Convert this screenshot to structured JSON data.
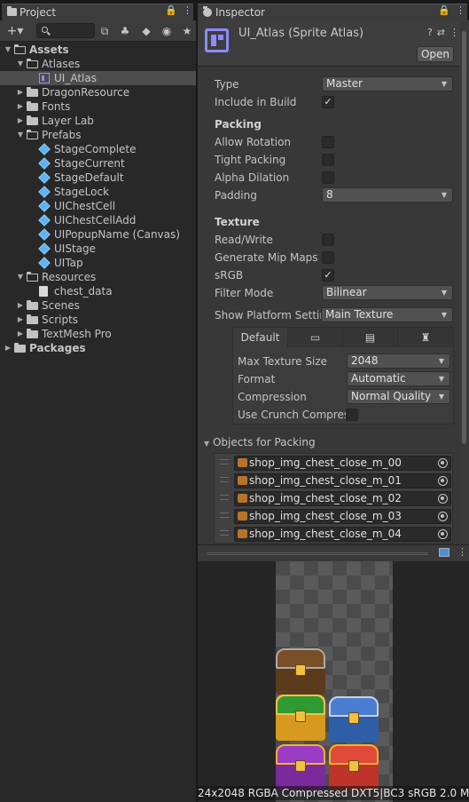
{
  "project": {
    "tab_label": "Project",
    "tab_controls": "🔒 ⋮",
    "toolbar": {
      "add": "+▾",
      "search_placeholder": ""
    },
    "tree": [
      {
        "label": "Assets",
        "indent": 0,
        "icon": "folder-open",
        "arrow": "▼",
        "bold": true
      },
      {
        "label": "Atlases",
        "indent": 1,
        "icon": "folder-open",
        "arrow": "▼"
      },
      {
        "label": "UI_Atlas",
        "indent": 2,
        "icon": "sprite-atlas",
        "arrow": "",
        "selected": true
      },
      {
        "label": "DragonResource",
        "indent": 1,
        "icon": "folder",
        "arrow": "▶"
      },
      {
        "label": "Fonts",
        "indent": 1,
        "icon": "folder",
        "arrow": "▶"
      },
      {
        "label": "Layer Lab",
        "indent": 1,
        "icon": "folder",
        "arrow": "▶"
      },
      {
        "label": "Prefabs",
        "indent": 1,
        "icon": "folder-open",
        "arrow": "▼"
      },
      {
        "label": "StageComplete",
        "indent": 2,
        "icon": "prefab",
        "arrow": ""
      },
      {
        "label": "StageCurrent",
        "indent": 2,
        "icon": "prefab",
        "arrow": ""
      },
      {
        "label": "StageDefault",
        "indent": 2,
        "icon": "prefab",
        "arrow": ""
      },
      {
        "label": "StageLock",
        "indent": 2,
        "icon": "prefab",
        "arrow": ""
      },
      {
        "label": "UIChestCell",
        "indent": 2,
        "icon": "prefab",
        "arrow": ""
      },
      {
        "label": "UIChestCellAdd",
        "indent": 2,
        "icon": "prefab",
        "arrow": ""
      },
      {
        "label": "UIPopupName (Canvas)",
        "indent": 2,
        "icon": "prefab",
        "arrow": ""
      },
      {
        "label": "UIStage",
        "indent": 2,
        "icon": "prefab",
        "arrow": ""
      },
      {
        "label": "UITap",
        "indent": 2,
        "icon": "prefab",
        "arrow": ""
      },
      {
        "label": "Resources",
        "indent": 1,
        "icon": "folder-open",
        "arrow": "▼"
      },
      {
        "label": "chest_data",
        "indent": 2,
        "icon": "text-file",
        "arrow": ""
      },
      {
        "label": "Scenes",
        "indent": 1,
        "icon": "folder",
        "arrow": "▶"
      },
      {
        "label": "Scripts",
        "indent": 1,
        "icon": "folder",
        "arrow": "▶"
      },
      {
        "label": "TextMesh Pro",
        "indent": 1,
        "icon": "folder",
        "arrow": "▶"
      },
      {
        "label": "Packages",
        "indent": 0,
        "icon": "folder",
        "arrow": "▶",
        "bold": true
      }
    ]
  },
  "inspector": {
    "tab_label": "Inspector",
    "tab_controls": "🔒 ⋮",
    "title": "UI_Atlas (Sprite Atlas)",
    "open_label": "Open",
    "header_icons": "? ⇄ ⋮",
    "type_label": "Type",
    "type_value": "Master",
    "include_label": "Include in Build",
    "include_checked": "✓",
    "packing_header": "Packing",
    "allow_rotation_label": "Allow Rotation",
    "tight_packing_label": "Tight Packing",
    "alpha_dilation_label": "Alpha Dilation",
    "padding_label": "Padding",
    "padding_value": "8",
    "texture_header": "Texture",
    "read_write_label": "Read/Write",
    "mipmaps_label": "Generate Mip Maps",
    "srgb_label": "sRGB",
    "srgb_checked": "✓",
    "filter_label": "Filter Mode",
    "filter_value": "Bilinear",
    "platform_label": "Show Platform Settir",
    "platform_value": "Main Texture",
    "platform_tabs": {
      "default": "Default",
      "desktop": "🖥",
      "webgl": "▤",
      "android": "🤖"
    },
    "max_size_label": "Max Texture Size",
    "max_size_value": "2048",
    "format_label": "Format",
    "format_value": "Automatic",
    "compression_label": "Compression",
    "compression_value": "Normal Quality",
    "crunch_label": "Use Crunch Compres",
    "objects_header": "Objects for Packing",
    "objects": [
      "shop_img_chest_close_m_00",
      "shop_img_chest_close_m_01",
      "shop_img_chest_close_m_02",
      "shop_img_chest_close_m_03",
      "shop_img_chest_close_m_04"
    ],
    "status_text": "24x2048 RGBA Compressed DXT5|BC3 sRGB   2.0 M"
  },
  "colors": {
    "accent": "#8d8cff",
    "prefab": "#5fb3ec",
    "selection": "#4d4d4d"
  }
}
